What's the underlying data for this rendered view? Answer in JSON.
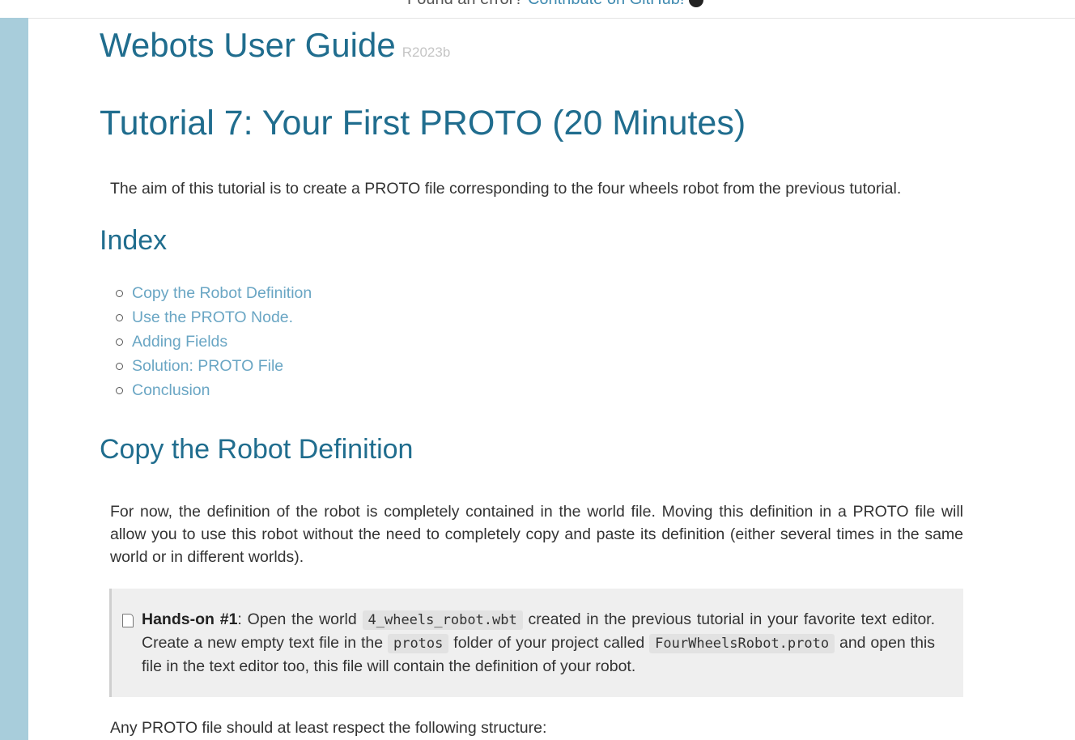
{
  "banner": {
    "prefix": "Found an error? ",
    "link": "Contribute on GitHub!",
    "icon": "github-icon"
  },
  "guide": {
    "title": "Webots User Guide",
    "version": "R2023b"
  },
  "page": {
    "title": "Tutorial 7: Your First PROTO (20 Minutes)",
    "intro": "The aim of this tutorial is to create a PROTO file corresponding to the four wheels robot from the previous tutorial."
  },
  "index": {
    "title": "Index",
    "items": [
      "Copy the Robot Definition",
      "Use the PROTO Node.",
      "Adding Fields",
      "Solution: PROTO File",
      "Conclusion"
    ]
  },
  "section1": {
    "title": "Copy the Robot Definition",
    "paragraph": "For now, the definition of the robot is completely contained in the world file. Moving this definition in a PROTO file will allow you to use this robot without the need to completely copy and paste its definition (either several times in the same world or in different worlds).",
    "handson": {
      "label": "Hands-on #1",
      "t1": ": Open the world ",
      "code1": "4_wheels_robot.wbt",
      "t2": " created in the previous tutorial in your favorite text editor. Create a new empty text file in the ",
      "code2": "protos",
      "t3": " folder of your project called ",
      "code3": "FourWheelsRobot.proto",
      "t4": " and open this file in the text editor too, this file will contain the definition of your robot."
    },
    "last": "Any PROTO file should at least respect the following structure:"
  },
  "colors": {
    "heading": "#206d8e",
    "link": "#6aa6c4",
    "sidebar": "#a8cddb",
    "note_bg": "#efefef"
  }
}
